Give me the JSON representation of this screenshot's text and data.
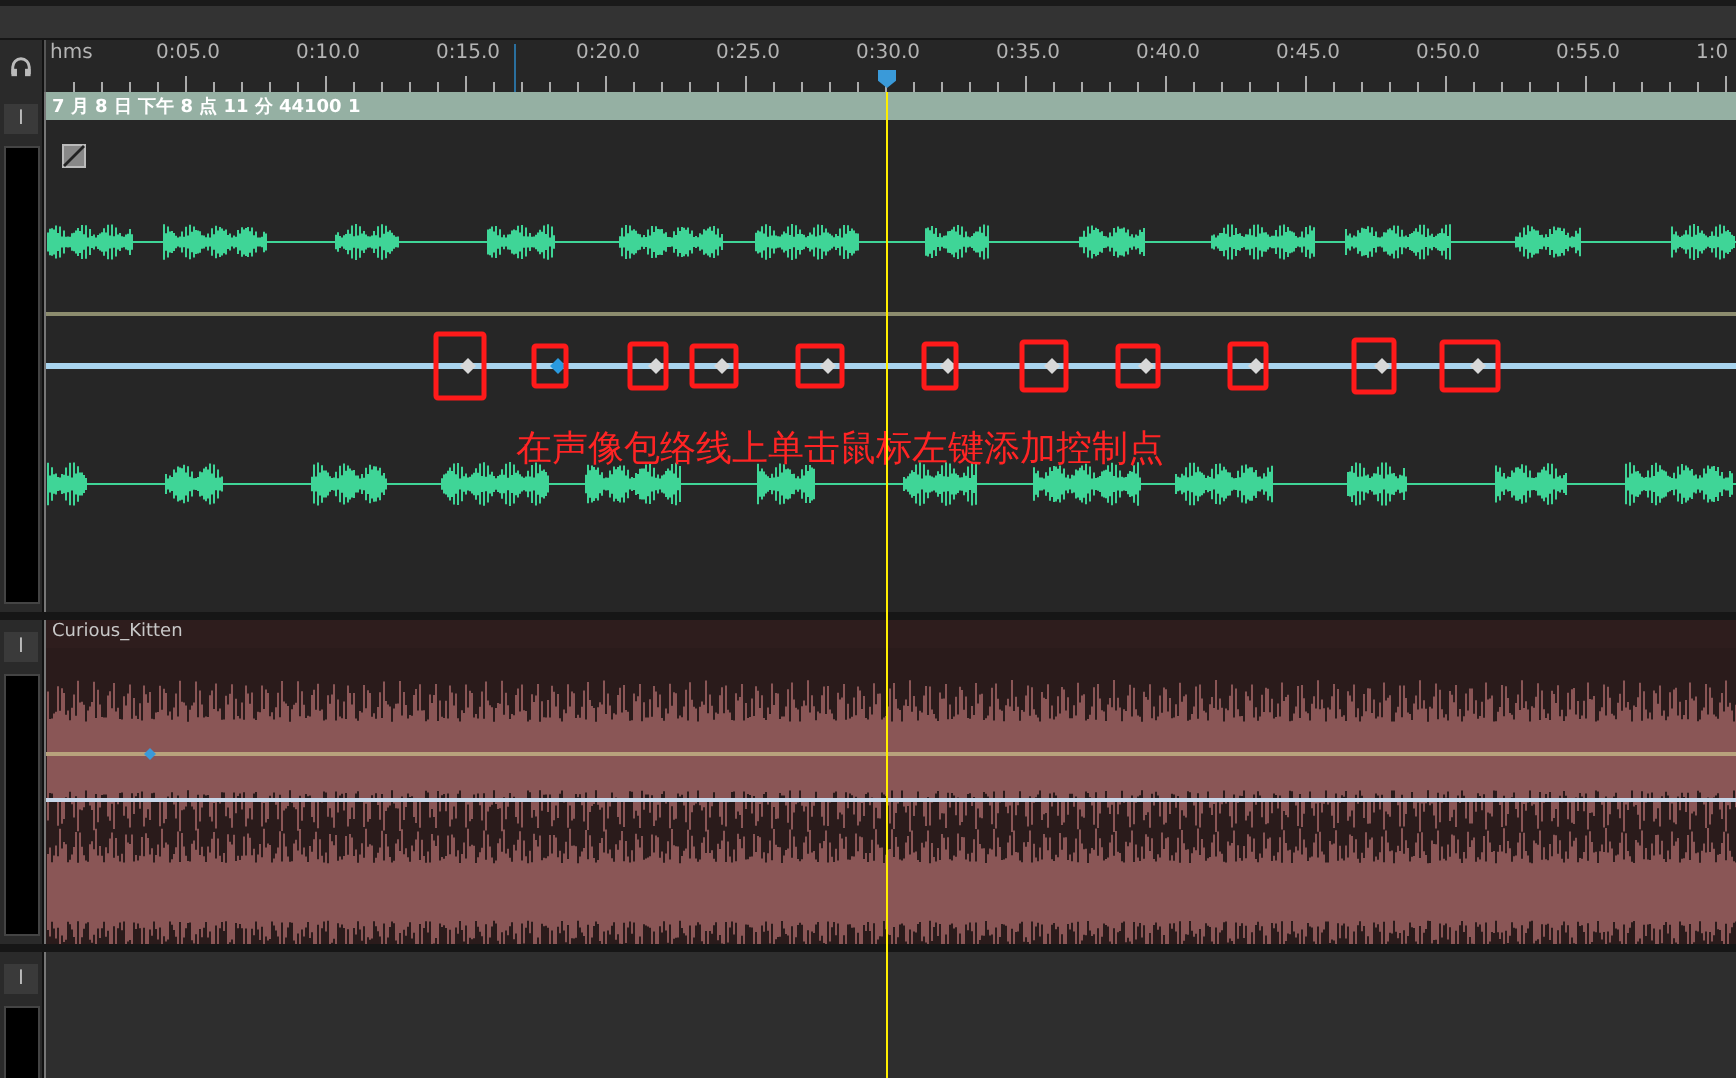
{
  "ruler": {
    "unit": "hms",
    "labels": [
      "0:05.0",
      "0:10.0",
      "0:15.0",
      "0:20.0",
      "0:25.0",
      "0:30.0",
      "0:35.0",
      "0:40.0",
      "0:45.0",
      "0:50.0",
      "0:55.0",
      "1:0"
    ]
  },
  "tracks": [
    {
      "kind": "voice",
      "button_label": "I",
      "clip_name": "7 月 8 日 下午 8 点 11 分 44100 1",
      "pan_points": [
        {
          "selected": false,
          "marked": true
        },
        {
          "selected": true,
          "marked": true
        },
        {
          "selected": false,
          "marked": true
        },
        {
          "selected": false,
          "marked": true
        },
        {
          "selected": false,
          "marked": true
        },
        {
          "selected": false,
          "marked": true
        },
        {
          "selected": false,
          "marked": true
        },
        {
          "selected": false,
          "marked": true
        },
        {
          "selected": false,
          "marked": true
        },
        {
          "selected": false,
          "marked": true
        },
        {
          "selected": false,
          "marked": true
        }
      ]
    },
    {
      "kind": "music",
      "button_label": "I",
      "clip_name": "Curious_Kitten"
    },
    {
      "kind": "empty",
      "button_label": "I"
    }
  ],
  "annotation": {
    "text": "在声像包络线上单击鼠标左键添加控制点"
  }
}
